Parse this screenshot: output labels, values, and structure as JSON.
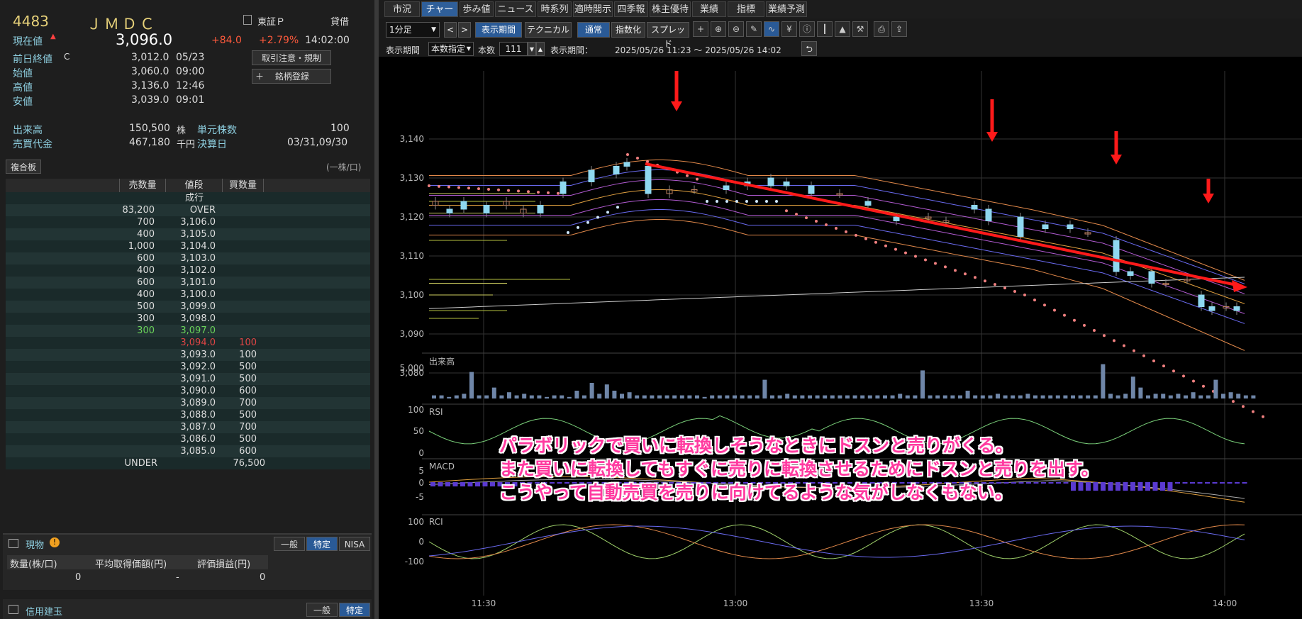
{
  "stock": {
    "code": "4483",
    "name": "ＪＭＤＣ",
    "market": "東証Ｐ",
    "margin": "貸借"
  },
  "price": {
    "label": "現在値",
    "value": "3,096.0",
    "change": "+84.0",
    "pct": "+2.79%",
    "time": "14:02:00"
  },
  "stats": [
    {
      "label": "前日終値",
      "flag": "C",
      "value": "3,012.0",
      "time": "05/23"
    },
    {
      "label": "始値",
      "flag": "",
      "value": "3,060.0",
      "time": "09:00"
    },
    {
      "label": "高値",
      "flag": "",
      "value": "3,136.0",
      "time": "12:46"
    },
    {
      "label": "安値",
      "flag": "",
      "value": "3,039.0",
      "time": "09:01"
    }
  ],
  "buttons": {
    "notice": "取引注意・規制",
    "register": "銘柄登録"
  },
  "volume": {
    "label": "出来高",
    "value": "150,500",
    "unit": "株",
    "unit_label": "単元株数",
    "unit_value": "100"
  },
  "turnover": {
    "label": "売買代金",
    "value": "467,180",
    "unit": "千円",
    "settle_label": "決算日",
    "settle_value": "03/31,09/30"
  },
  "board": {
    "title": "複合板",
    "unit": "(一株/口)",
    "headers": [
      "売数量",
      "値段",
      "買数量"
    ],
    "rows": [
      {
        "sell": "",
        "price": "成行",
        "buy": ""
      },
      {
        "sell": "83,200",
        "price": "OVER",
        "buy": ""
      },
      {
        "sell": "700",
        "price": "3,106.0",
        "buy": ""
      },
      {
        "sell": "400",
        "price": "3,105.0",
        "buy": ""
      },
      {
        "sell": "1,000",
        "price": "3,104.0",
        "buy": ""
      },
      {
        "sell": "600",
        "price": "3,103.0",
        "buy": ""
      },
      {
        "sell": "400",
        "price": "3,102.0",
        "buy": ""
      },
      {
        "sell": "600",
        "price": "3,101.0",
        "buy": ""
      },
      {
        "sell": "400",
        "price": "3,100.0",
        "buy": ""
      },
      {
        "sell": "500",
        "price": "3,099.0",
        "buy": ""
      },
      {
        "sell": "300",
        "price": "3,098.0",
        "buy": ""
      },
      {
        "sell": "300",
        "price": "3,097.0",
        "buy": "",
        "color": "#6ad35a"
      },
      {
        "sell": "",
        "price": "3,094.0",
        "buy": "100",
        "color": "#e04545"
      },
      {
        "sell": "",
        "price": "3,093.0",
        "buy": "100"
      },
      {
        "sell": "",
        "price": "3,092.0",
        "buy": "500"
      },
      {
        "sell": "",
        "price": "3,091.0",
        "buy": "500"
      },
      {
        "sell": "",
        "price": "3,090.0",
        "buy": "600"
      },
      {
        "sell": "",
        "price": "3,089.0",
        "buy": "700"
      },
      {
        "sell": "",
        "price": "3,088.0",
        "buy": "500"
      },
      {
        "sell": "",
        "price": "3,087.0",
        "buy": "700"
      },
      {
        "sell": "",
        "price": "3,086.0",
        "buy": "500"
      },
      {
        "sell": "",
        "price": "3,085.0",
        "buy": "600"
      },
      {
        "sell": "UNDER",
        "price": "",
        "buy": "76,500",
        "under": true
      }
    ]
  },
  "position": {
    "title": "現物",
    "tabs": [
      "一般",
      "特定",
      "NISA"
    ],
    "headers": [
      "数量(株/口)",
      "平均取得価額(円)",
      "評価損益(円)"
    ],
    "values": [
      "0",
      "-",
      "0"
    ]
  },
  "credit": {
    "title": "信用建玉",
    "tabs": [
      "一般",
      "特定"
    ]
  },
  "tabs": [
    "市況",
    "チャート",
    "歩み値",
    "ニュース",
    "時系列",
    "適時開示",
    "四季報",
    "株主優待",
    "業績",
    "指標",
    "業績予測"
  ],
  "toolbar": {
    "interval": "1分足",
    "period_btn": "表示期間",
    "technical_btn": "テクニカル",
    "mode_normal": "通常",
    "mode_index": "指数化",
    "mode_spread": "スプレッド"
  },
  "period": {
    "label": "表示期間",
    "select": "本数指定",
    "count_label": "本数",
    "count": "111",
    "range_label": "表示期間：",
    "range": "2025/05/26 11:23 〜 2025/05/26 14:02"
  },
  "price_axis": [
    "3,140",
    "3,130",
    "3,120",
    "3,110",
    "3,100",
    "3,090",
    "3,080"
  ],
  "vol_panel": {
    "label": "出来高",
    "tick": "5,000"
  },
  "rsi_panel": {
    "label": "RSI",
    "ticks": [
      "100",
      "50",
      "0"
    ]
  },
  "macd_panel": {
    "label": "MACD",
    "ticks": [
      "5",
      "0",
      "-5"
    ]
  },
  "rci_panel": {
    "label": "RCI",
    "ticks": [
      "100",
      "0",
      "-100"
    ]
  },
  "time_axis": [
    "11:30",
    "13:00",
    "13:30",
    "14:00"
  ],
  "annotation": [
    "パラボリックで買いに転換しそうなときにドスンと売りがくる。",
    "また買いに転換してもすぐに売りに転換させるためにドスンと売りを出す。",
    "こうやって自動売買を売りに向けてるような気がしなくもない。"
  ],
  "colors": {
    "up": "#ff5a3c",
    "candle": "#8fd8f0",
    "sar": "#f08080",
    "arrow": "#ff1a1a",
    "annotation": "#ff3aa0"
  }
}
